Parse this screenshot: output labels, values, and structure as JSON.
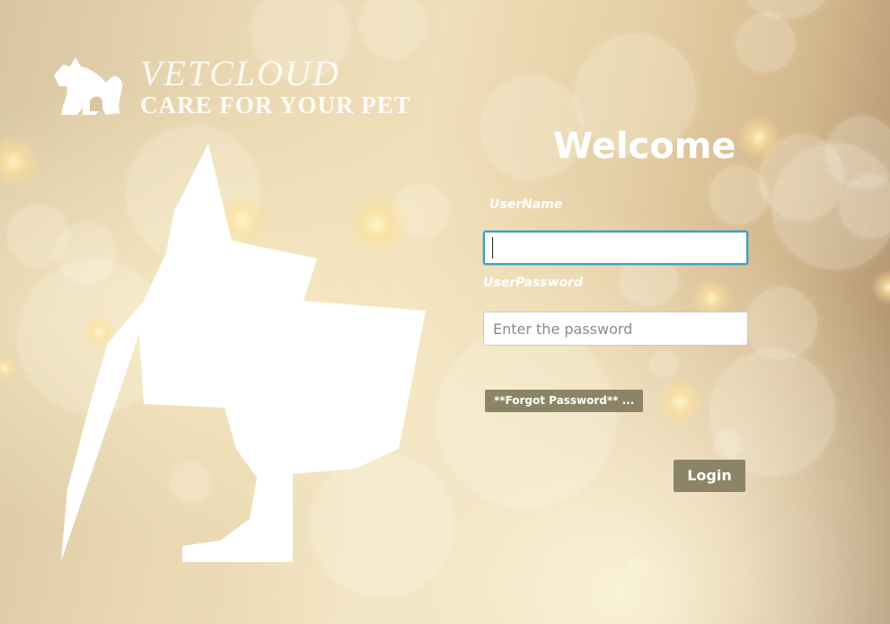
{
  "brand": {
    "name": "VETCLOUD",
    "tagline": "CARE FOR YOUR PET",
    "logo_icon": "dog-and-cat-icon"
  },
  "login_form": {
    "title": "Welcome",
    "username_label": "UserName",
    "username_value": "",
    "username_placeholder": "",
    "password_label": "UserPassword",
    "password_value": "",
    "password_placeholder": "Enter the password",
    "forgot_password_label": "**Forgot Password**  ...",
    "login_label": "Login"
  },
  "colors": {
    "button_background": "#8c8466",
    "focus_border": "#3aa0c8",
    "text_on_background": "#ffffff"
  }
}
